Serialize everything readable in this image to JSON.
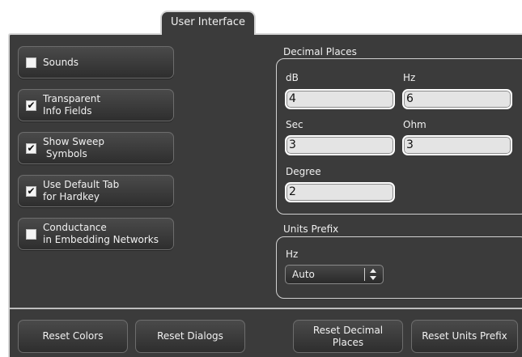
{
  "tab": {
    "label": "User Interface"
  },
  "options": [
    {
      "label": "Sounds",
      "checked": false
    },
    {
      "label": "Transparent\nInfo Fields",
      "checked": true
    },
    {
      "label": "Show Sweep\n Symbols",
      "checked": true
    },
    {
      "label": "Use Default Tab\nfor Hardkey",
      "checked": true
    },
    {
      "label": "Conductance\nin Embedding Networks",
      "checked": false
    }
  ],
  "decimal_places": {
    "title": "Decimal Places",
    "fields": [
      {
        "label": "dB",
        "value": "4"
      },
      {
        "label": "Hz",
        "value": "6"
      },
      {
        "label": "Sec",
        "value": "3"
      },
      {
        "label": "Ohm",
        "value": "3"
      },
      {
        "label": "Degree",
        "value": "2"
      }
    ]
  },
  "units_prefix": {
    "title": "Units Prefix",
    "field_label": "Hz",
    "selected": "Auto"
  },
  "buttons": {
    "reset_colors": "Reset Colors",
    "reset_dialogs": "Reset Dialogs",
    "reset_decimal_places": "Reset Decimal\nPlaces",
    "reset_units_prefix": "Reset Units Prefix"
  },
  "colors": {
    "panel": "#3b3b3b",
    "field": "#e4e4e4",
    "border": "#d6d6d6"
  }
}
